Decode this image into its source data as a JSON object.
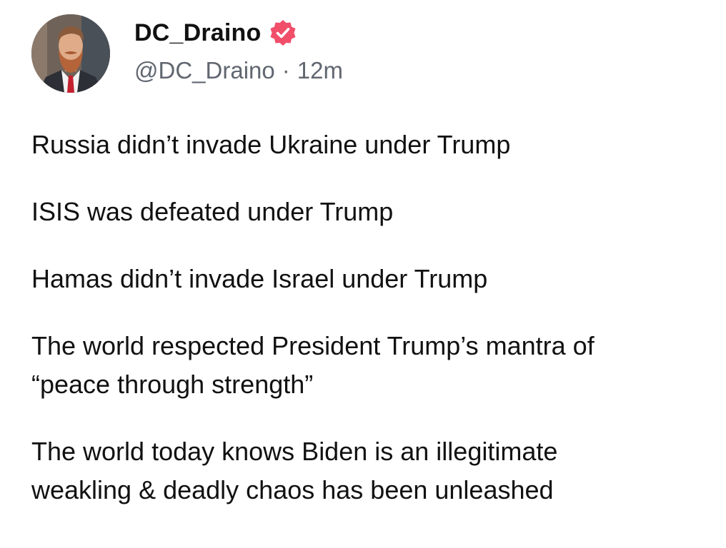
{
  "post": {
    "author": {
      "display_name": "DC_Draino",
      "handle": "@DC_Draino",
      "separator": "·",
      "time_ago": "12m",
      "verified_icon": "verified-badge-icon",
      "verified_color": "#f14e6a"
    },
    "paragraphs": [
      "Russia didn’t invade Ukraine under Trump",
      "ISIS was defeated under Trump",
      "Hamas didn’t invade Israel under Trump",
      "The world respected President Trump’s mantra of\n“peace through strength”",
      "The world today knows Biden is an illegitimate\nweakling & deadly chaos has been unleashed"
    ]
  }
}
